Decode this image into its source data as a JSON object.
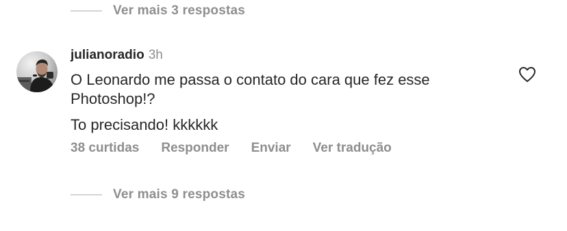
{
  "replies_top": {
    "label": "Ver mais 3 respostas"
  },
  "comment": {
    "username": "julianoradio",
    "timestamp": "3h",
    "text_line1": "O Leonardo me passa o contato do cara que fez esse Photoshop!?",
    "text_line2": "To precisando! kkkkkk",
    "avatar_icon": "user-avatar-photo",
    "like_icon": "heart-outline-icon",
    "actions": {
      "likes": "38 curtidas",
      "reply": "Responder",
      "send": "Enviar",
      "translate": "Ver tradução"
    }
  },
  "replies_bottom": {
    "label": "Ver mais 9 respostas"
  },
  "colors": {
    "text_primary": "#262626",
    "text_secondary": "#8e8e8e",
    "divider": "#d4d4d4"
  }
}
